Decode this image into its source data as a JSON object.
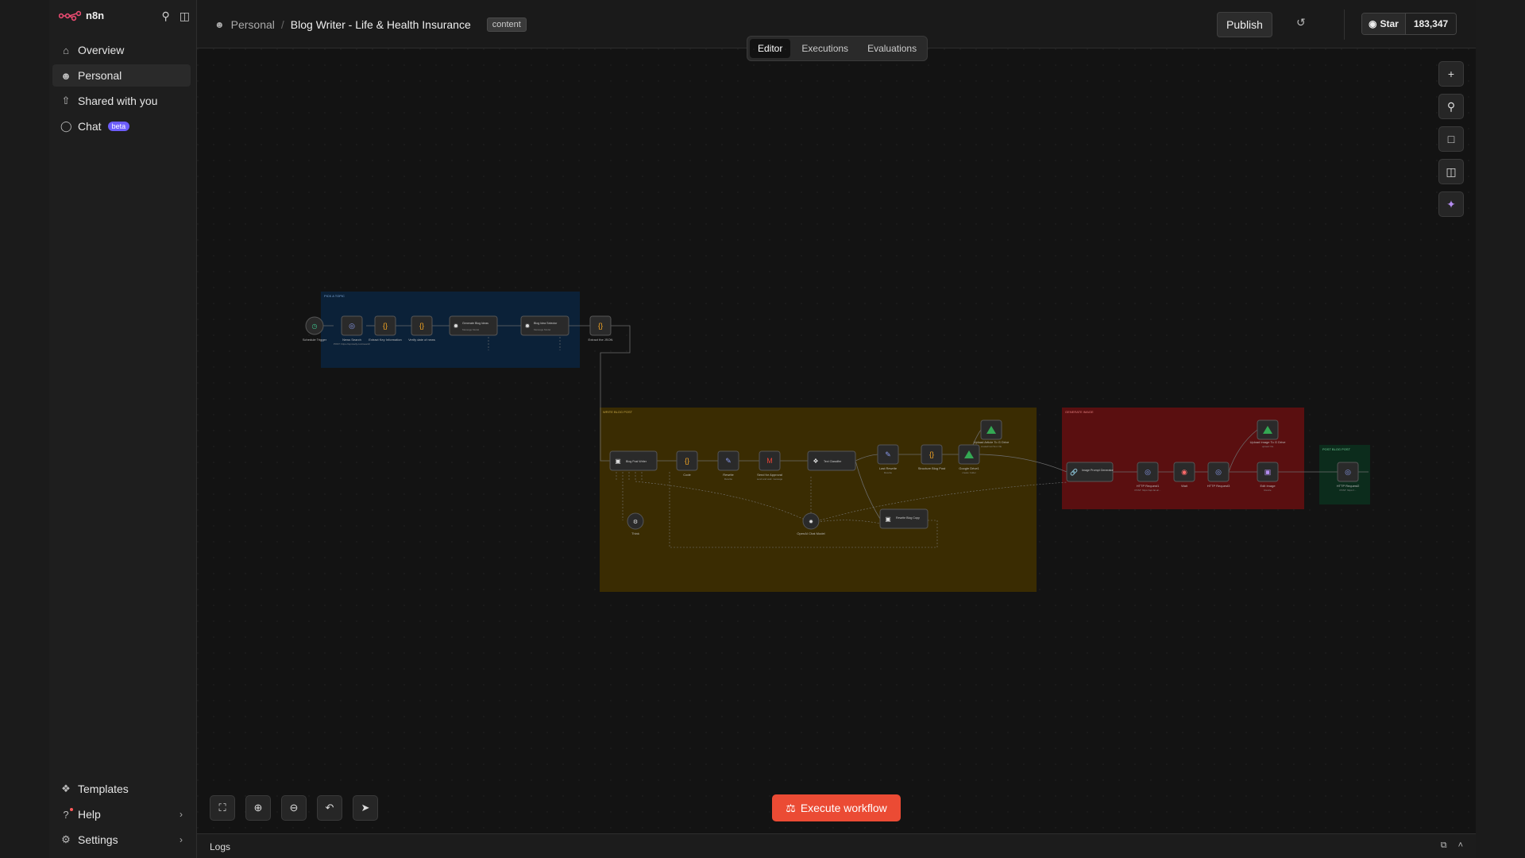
{
  "app": {
    "name": "n8n"
  },
  "sidebar": {
    "items": [
      {
        "label": "Overview"
      },
      {
        "label": "Personal"
      },
      {
        "label": "Shared with you"
      },
      {
        "label": "Chat",
        "badge": "beta"
      }
    ],
    "bottom": [
      {
        "label": "Templates"
      },
      {
        "label": "Help"
      },
      {
        "label": "Settings"
      }
    ]
  },
  "header": {
    "project": "Personal",
    "workflow_title": "Blog Writer - Life & Health Insurance",
    "tag": "content",
    "publish_label": "Publish",
    "github": {
      "star_label": "Star",
      "count": "183,347"
    }
  },
  "tabs": [
    {
      "label": "Editor",
      "active": true
    },
    {
      "label": "Executions"
    },
    {
      "label": "Evaluations"
    }
  ],
  "execute_label": "Execute workflow",
  "logs_label": "Logs",
  "colors": {
    "accent": "#eb4b34",
    "group_blue": "#0b2138",
    "group_yellow": "#3a2c02",
    "group_red": "#5a0f10",
    "group_green": "#0c2c1c"
  },
  "workflow": {
    "groups": [
      {
        "label": "PICK A TOPIC"
      },
      {
        "label": "WRITE BLOG POST"
      },
      {
        "label": "GENERATE IMAGE"
      },
      {
        "label": "POST BLOG POST"
      }
    ],
    "nodes": [
      {
        "label": "Schedule Trigger",
        "sub": ""
      },
      {
        "label": "News Search",
        "sub": "POST: https://api.tavily.com/search"
      },
      {
        "label": "Extract Key Information",
        "sub": ""
      },
      {
        "label": "Verify date of news",
        "sub": ""
      },
      {
        "label": "Generate Blog Ideas",
        "sub": "Message Model"
      },
      {
        "label": "Blog Idea Selector",
        "sub": "Message Model"
      },
      {
        "label": "Extract the JSON",
        "sub": ""
      },
      {
        "label": "Blog Post Writer",
        "sub": ""
      },
      {
        "label": "Code",
        "sub": ""
      },
      {
        "label": "Rewrite",
        "sub": "Rewrite"
      },
      {
        "label": "Send for Approval",
        "sub": "send and wait: message"
      },
      {
        "label": "Text Classifier",
        "sub": ""
      },
      {
        "label": "Last Rewrite",
        "sub": "Rewrite"
      },
      {
        "label": "Structure Blog Post",
        "sub": ""
      },
      {
        "label": "Google Drive1",
        "sub": "create: folder"
      },
      {
        "label": "Upload Article To G Drive",
        "sub": "createFromText: file"
      },
      {
        "label": "Think",
        "sub": ""
      },
      {
        "label": "OpenAI Chat Model",
        "sub": ""
      },
      {
        "label": "Rewrite Blog Copy",
        "sub": ""
      },
      {
        "label": "Image Prompt Generator",
        "sub": ""
      },
      {
        "label": "HTTP Request1",
        "sub": "POST: https://api.fal.ai/..."
      },
      {
        "label": "Wait",
        "sub": ""
      },
      {
        "label": "HTTP Request3",
        "sub": ""
      },
      {
        "label": "Upload Image To G Drive",
        "sub": "upload: file"
      },
      {
        "label": "Edit Image",
        "sub": "Resize"
      },
      {
        "label": "HTTP Request2",
        "sub": "POST: https://..."
      }
    ]
  }
}
